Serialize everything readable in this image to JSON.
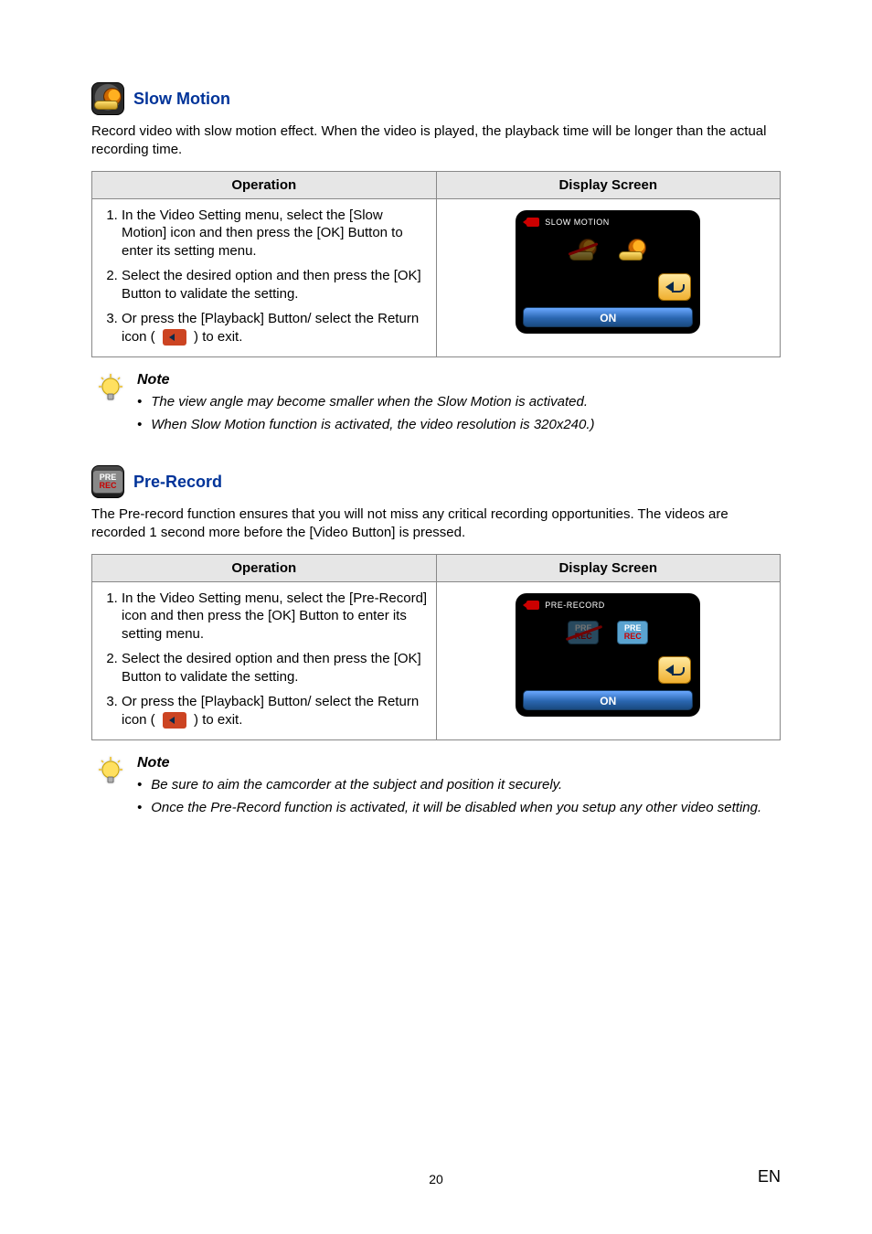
{
  "section1": {
    "icon_name": "slow-motion-icon",
    "title": "Slow Motion",
    "intro": "Record video with slow motion effect. When the video is played, the playback time will be longer than the actual recording time.",
    "th_operation": "Operation",
    "th_display": "Display Screen",
    "steps": {
      "s1": "In the Video Setting menu, select the [Slow Motion] icon and then press the [OK] Button to enter its setting menu.",
      "s2": "Select the desired option and then press the [OK] Button to validate the setting.",
      "s3_pre": "Or press the [Playback] Button/ select the Return icon (",
      "s3_post": ") to exit."
    },
    "screen": {
      "title": "SLOW MOTION",
      "on_label": "ON"
    },
    "note_title": "Note",
    "note1": "The view angle may become smaller when the Slow Motion is activated.",
    "note2": "When Slow Motion function is activated, the video resolution is 320x240.)"
  },
  "section2": {
    "icon_name": "pre-record-icon",
    "chip_top": "PRE",
    "chip_bot": "REC",
    "title": "Pre-Record",
    "intro": "The Pre-record function ensures that you will not miss any critical recording opportunities. The videos are recorded 1 second more before the [Video Button] is pressed.",
    "th_operation": "Operation",
    "th_display": "Display Screen",
    "steps": {
      "s1": "In the Video Setting menu, select the [Pre-Record] icon and then press the [OK] Button to enter its setting menu.",
      "s2": "Select the desired option and then press the [OK] Button to validate the setting.",
      "s3_pre": "Or press the [Playback] Button/ select the Return icon (",
      "s3_post": ") to exit."
    },
    "screen": {
      "title": "PRE-RECORD",
      "on_label": "ON"
    },
    "note_title": "Note",
    "note1": "Be sure to aim the camcorder at the subject and position it securely.",
    "note2": "Once the Pre-Record function is activated, it will be disabled when you setup any other video setting."
  },
  "footer": {
    "page": "20",
    "lang": "EN"
  }
}
